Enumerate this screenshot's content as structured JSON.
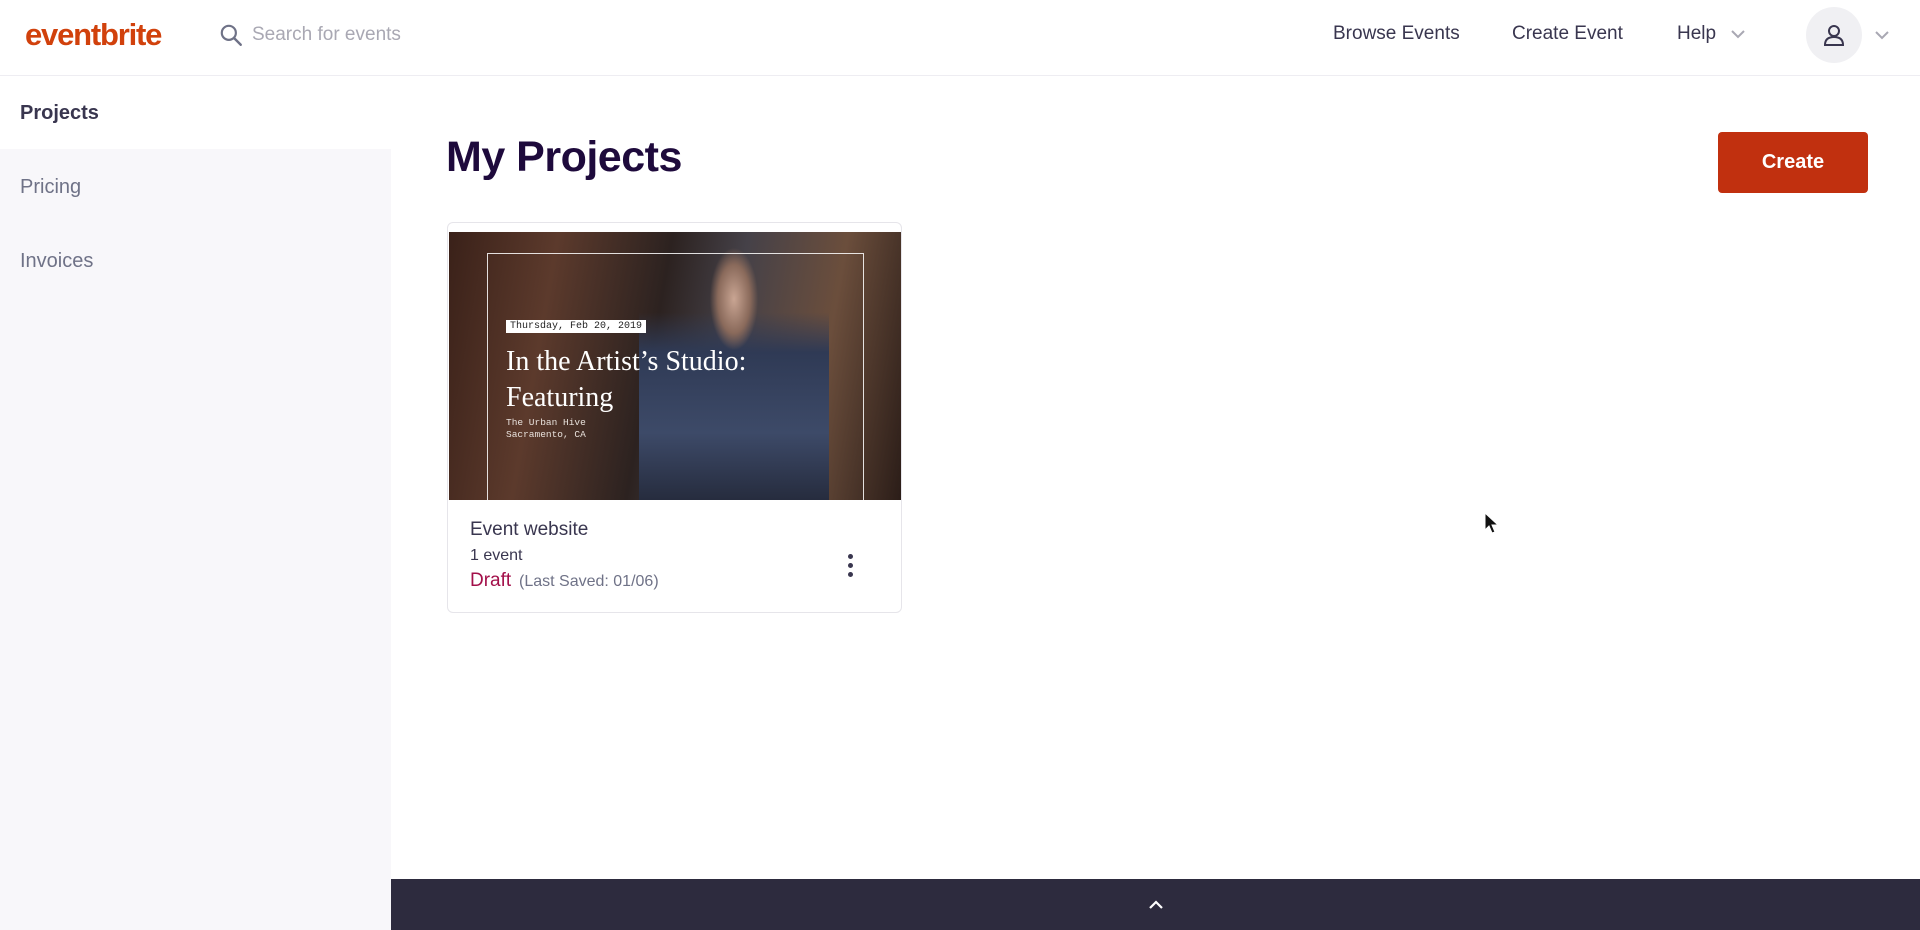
{
  "header": {
    "logo_text": "eventbrite",
    "search_placeholder": "Search for events",
    "nav": {
      "browse_events": "Browse Events",
      "create_event": "Create Event",
      "help": "Help"
    },
    "icons": [
      "search-icon",
      "chevron-down-icon",
      "user-icon"
    ]
  },
  "sidebar": {
    "items": [
      {
        "label": "Projects",
        "active": true
      },
      {
        "label": "Pricing",
        "active": false
      },
      {
        "label": "Invoices",
        "active": false
      }
    ]
  },
  "main": {
    "title": "My Projects",
    "create_button": "Create",
    "projects": [
      {
        "image": {
          "date": "Thursday, Feb 20, 2019",
          "title": "In the Artist’s Studio: Featuring",
          "venue_line1": "The Urban Hive",
          "venue_line2": "Sacramento, CA"
        },
        "name": "Event website",
        "event_count": "1 event",
        "status": "Draft",
        "last_saved": "(Last Saved: 01/06)"
      }
    ]
  },
  "colors": {
    "brand": "#d1410c",
    "create_button": "#c1300f",
    "draft_status": "#a3104a",
    "bottom_bar": "#2d2b3e",
    "sidebar_bg": "#f8f7fa"
  }
}
